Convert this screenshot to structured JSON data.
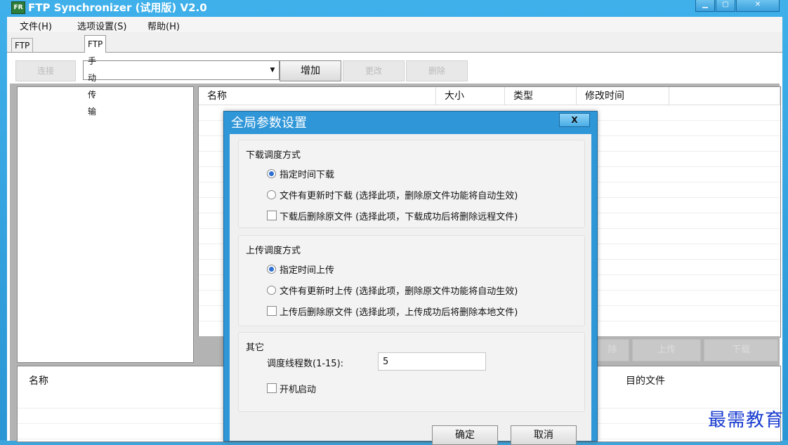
{
  "window": {
    "title": "FTP Synchronizer (试用版) V2.0",
    "icon_label": "FR",
    "controls": [
      "▁",
      "▢",
      "✕"
    ]
  },
  "menu": {
    "items": [
      "文件(H)",
      "选项设置(S)",
      "帮助(H)"
    ]
  },
  "tabs": [
    {
      "label": "FTP自动传输",
      "active": false
    },
    {
      "label": "FTP手动传输",
      "active": true
    }
  ],
  "toolbar": {
    "connect_label": "连接",
    "site_select_value": "",
    "add_label": "增加",
    "edit_label": "更改",
    "delete_label": "删除"
  },
  "file_list": {
    "columns": [
      "名称",
      "大小",
      "类型",
      "修改时间"
    ]
  },
  "actions": {
    "delete_label": "除",
    "upload_label": "上传",
    "download_label": "下载"
  },
  "queue": {
    "columns": [
      "名称",
      "目的文件"
    ]
  },
  "dialog": {
    "title": "全局参数设置",
    "close_label": "X",
    "download_group": {
      "title": "下载调度方式",
      "option_scheduled": "指定时间下载",
      "option_on_update": "文件有更新时下载 (选择此项，删除原文件功能将自动生效)",
      "delete_after": "下载后删除原文件 (选择此项，下载成功后将删除远程文件)",
      "selected": "scheduled"
    },
    "upload_group": {
      "title": "上传调度方式",
      "option_scheduled": "指定时间上传",
      "option_on_update": "文件有更新时上传 (选择此项，删除原文件功能将自动生效)",
      "delete_after": "上传后删除原文件 (选择此项，上传成功后将删除本地文件)",
      "selected": "scheduled"
    },
    "other_group": {
      "title": "其它",
      "threads_label": "调度线程数(1-15):",
      "threads_value": "5",
      "startup_label": "开机启动"
    },
    "ok_label": "确定",
    "cancel_label": "取消"
  },
  "watermark": "最需教育"
}
